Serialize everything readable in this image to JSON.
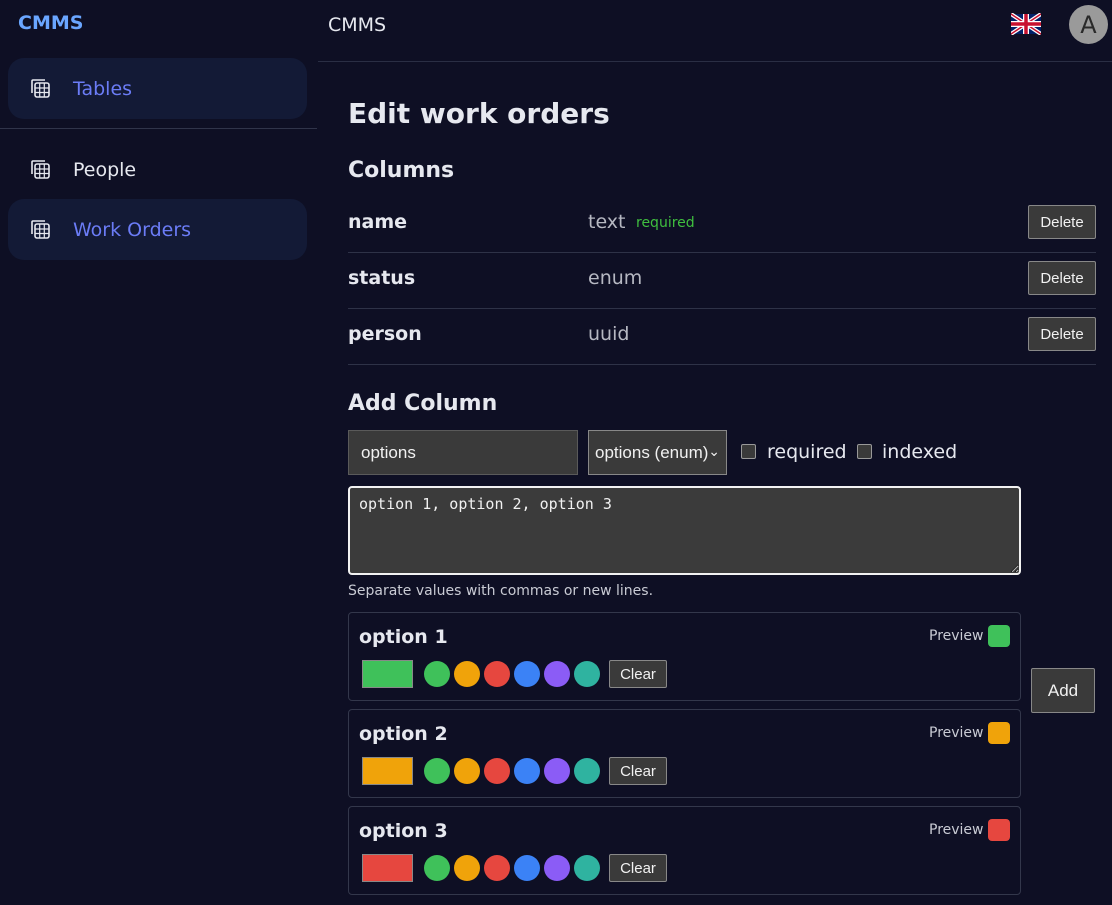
{
  "sidebar": {
    "brand": "CMMS",
    "tables_label": "Tables",
    "items": [
      {
        "label": "People",
        "icon": "table-icon"
      },
      {
        "label": "Work Orders",
        "icon": "table-icon"
      }
    ]
  },
  "header": {
    "title": "CMMS",
    "flag_icon": "uk-flag-icon",
    "avatar_letter": "A"
  },
  "main": {
    "page_title": "Edit work orders",
    "columns_title": "Columns",
    "columns": [
      {
        "name": "name",
        "type": "text",
        "badge": "required",
        "delete_label": "Delete"
      },
      {
        "name": "status",
        "type": "enum",
        "badge": "",
        "delete_label": "Delete"
      },
      {
        "name": "person",
        "type": "uuid",
        "badge": "",
        "delete_label": "Delete"
      }
    ],
    "add_column": {
      "title": "Add Column",
      "name_value": "options",
      "type_value": "options (enum)",
      "required_label": "required",
      "indexed_label": "indexed",
      "options_text": "option 1, option 2, option 3",
      "help_text": "Separate values with commas or new lines.",
      "preview_label": "Preview",
      "clear_label": "Clear",
      "add_label": "Add",
      "palette": [
        "#3fc15a",
        "#f0a30a",
        "#e6473f",
        "#3b82f6",
        "#8b5cf6",
        "#2fb3a0"
      ],
      "options": [
        {
          "label": "option 1",
          "color": "#3fc15a"
        },
        {
          "label": "option 2",
          "color": "#f0a30a"
        },
        {
          "label": "option 3",
          "color": "#e6473f"
        }
      ]
    }
  }
}
